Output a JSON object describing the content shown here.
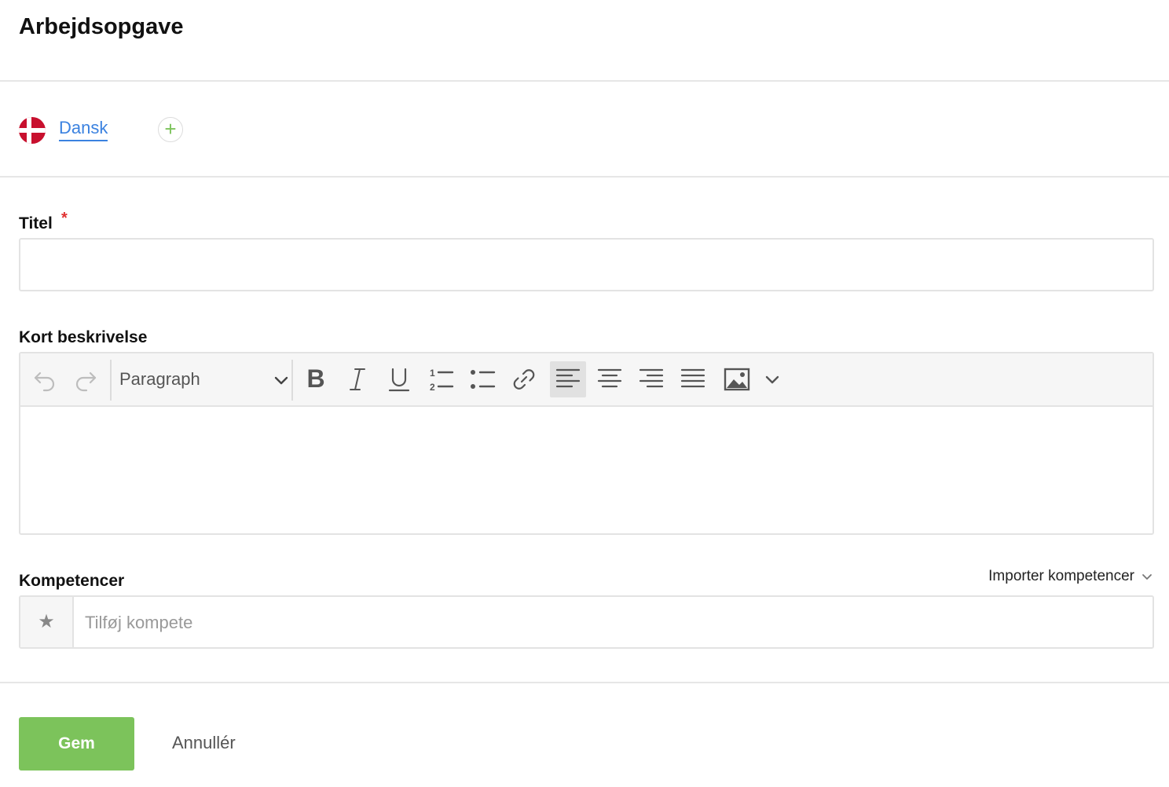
{
  "header": {
    "title": "Arbejdsopgave"
  },
  "languages": {
    "active_tab": "Dansk",
    "active_flag": "denmark-flag-icon",
    "add_icon": "plus-icon"
  },
  "form": {
    "title_label": "Titel",
    "title_required_marker": "*",
    "title_value": "",
    "description_label": "Kort beskrivelse",
    "editor": {
      "paragraph_select": "Paragraph",
      "toolbar_icons": [
        "undo-icon",
        "redo-icon",
        "bold-icon",
        "italic-icon",
        "underline-icon",
        "ordered-list-icon",
        "bullet-list-icon",
        "link-icon",
        "align-left-icon",
        "align-center-icon",
        "align-right-icon",
        "align-justify-icon",
        "image-icon",
        "more-chevron-icon"
      ],
      "active_alignment": "align-left"
    },
    "competences_label": "Kompetencer",
    "import_competences": "Importer kompetencer",
    "competences_placeholder": "Tilføj kompete"
  },
  "footer": {
    "save_label": "Gem",
    "cancel_label": "Annullér"
  },
  "colors": {
    "accent_blue": "#3b82e0",
    "save_green": "#7cc35b",
    "required_red": "#e03131"
  }
}
